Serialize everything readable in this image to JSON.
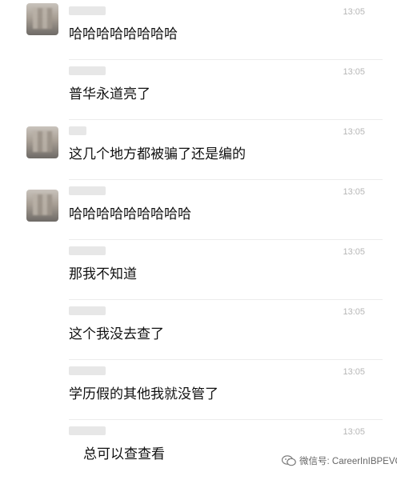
{
  "chat": {
    "messages": [
      {
        "time": "13:05",
        "text": "哈哈哈哈哈哈哈哈",
        "has_avatar": true
      },
      {
        "time": "13:05",
        "text": "普华永道亮了",
        "has_avatar": false
      },
      {
        "time": "13:05",
        "text": "这几个地方都被骗了还是编的",
        "has_avatar": true
      },
      {
        "time": "13:05",
        "text": "哈哈哈哈哈哈哈哈哈",
        "has_avatar": true
      },
      {
        "time": "13:05",
        "text": "那我不知道",
        "has_avatar": false
      },
      {
        "time": "13:05",
        "text": "这个我没去查了",
        "has_avatar": false
      },
      {
        "time": "13:05",
        "text": "学历假的其他我就没管了",
        "has_avatar": false
      },
      {
        "time": "13:05",
        "text": "总可以查查看",
        "has_avatar": false
      }
    ]
  },
  "watermark": {
    "icon": "wechat-icon",
    "text": "微信号: CareerInIBPEVC"
  }
}
